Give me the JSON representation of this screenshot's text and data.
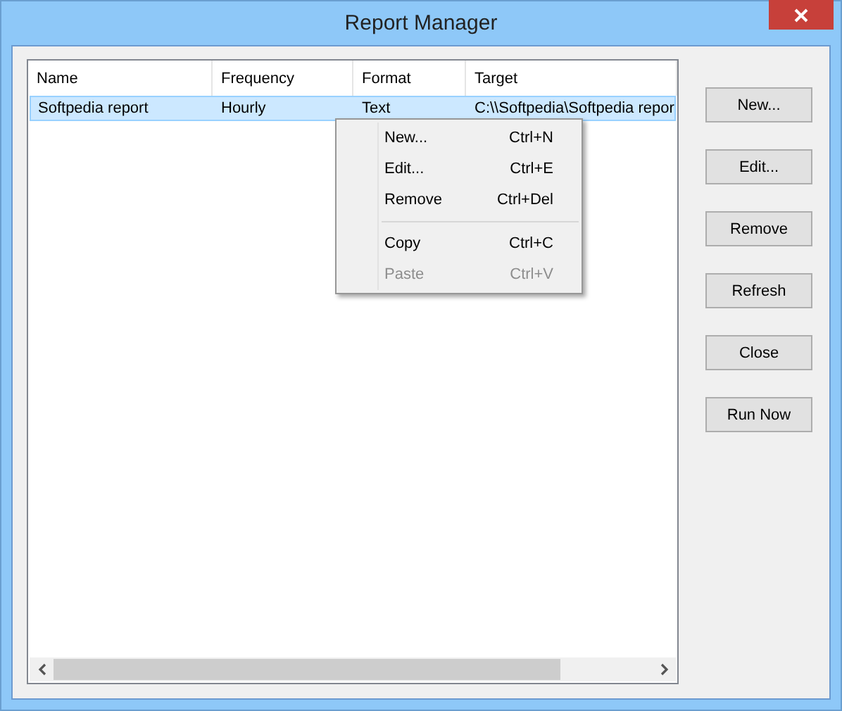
{
  "window": {
    "title": "Report Manager"
  },
  "table": {
    "columns": [
      "Name",
      "Frequency",
      "Format",
      "Target"
    ],
    "rows": [
      {
        "cells": [
          "Softpedia report",
          "Hourly",
          "Text",
          "C:\\\\Softpedia\\Softpedia repor"
        ],
        "selected": true
      }
    ]
  },
  "context_menu": {
    "groups": [
      [
        {
          "label": "New...",
          "shortcut": "Ctrl+N",
          "disabled": false
        },
        {
          "label": "Edit...",
          "shortcut": "Ctrl+E",
          "disabled": false
        },
        {
          "label": "Remove",
          "shortcut": "Ctrl+Del",
          "disabled": false
        }
      ],
      [
        {
          "label": "Copy",
          "shortcut": "Ctrl+C",
          "disabled": false
        },
        {
          "label": "Paste",
          "shortcut": "Ctrl+V",
          "disabled": true
        }
      ]
    ]
  },
  "buttons": [
    "New...",
    "Edit...",
    "Remove",
    "Refresh",
    "Close",
    "Run Now"
  ]
}
